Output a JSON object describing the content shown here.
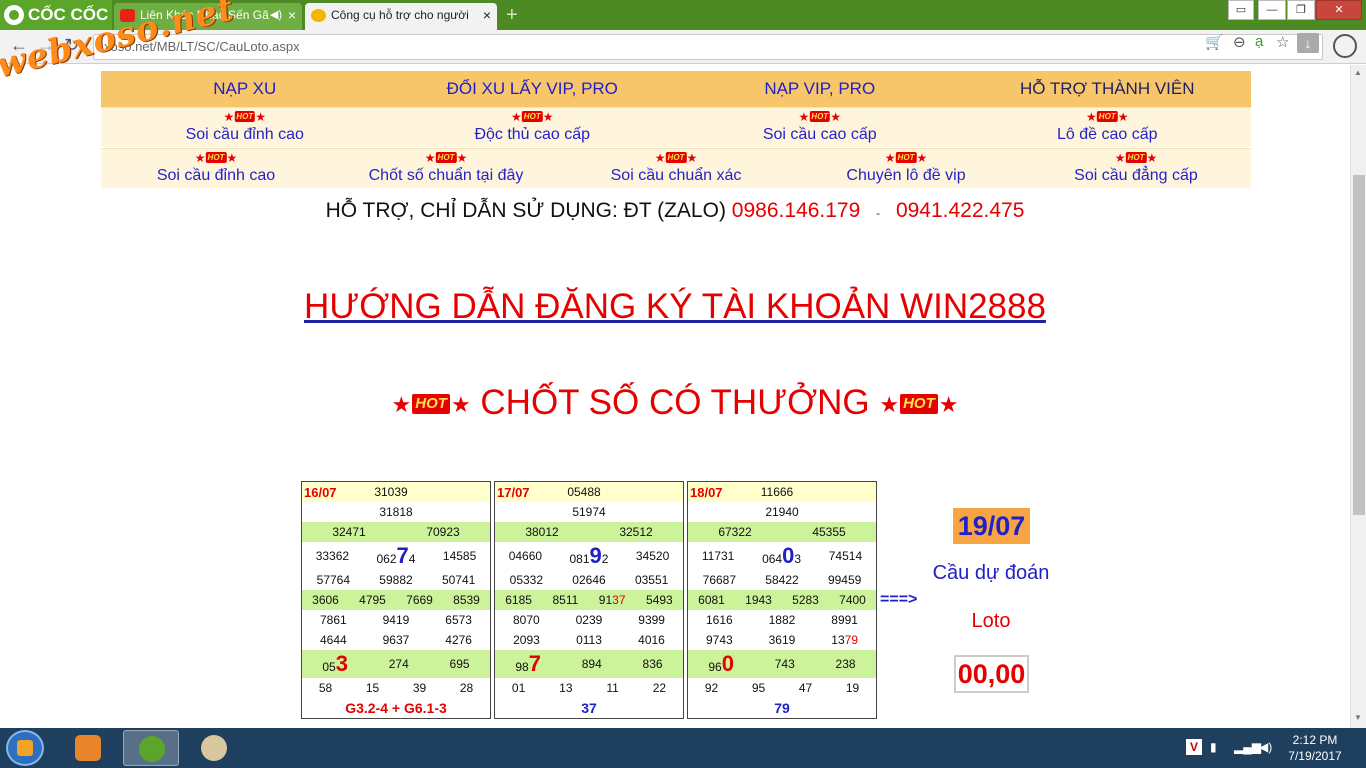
{
  "browser": {
    "brand": "CỐC CỐC",
    "tabs": [
      {
        "title": "Liên Khúc Nhạc Sến Gã",
        "active": false
      },
      {
        "title": "Công cụ hỗ trợ cho người",
        "active": true
      }
    ],
    "url": "xoso.net/MB/LT/SC/CauLoto.aspx",
    "window_buttons": {
      "minimize": "—",
      "restore": "❐",
      "close": "✕"
    }
  },
  "watermark": "webxoso.net",
  "nav": {
    "top_items": [
      "NẠP XU",
      "ĐỔI XU LẤY VIP, PRO",
      "NẠP VIP, PRO",
      "HỖ TRỢ THÀNH VIÊN"
    ],
    "hot_label": "HOT",
    "row1": [
      "Soi cầu đỉnh cao",
      "Độc thủ cao cấp",
      "Soi cầu cao cấp",
      "Lô đề cao cấp"
    ],
    "row2": [
      "Soi cầu đỉnh cao",
      "Chốt số chuẩn tại đây",
      "Soi cầu chuẩn xác",
      "Chuyên lô đề vip",
      "Soi cầu đẳng cấp"
    ]
  },
  "support": {
    "text": "HỖ TRỢ, CHỈ DẪN SỬ DỤNG: ĐT (ZALO)",
    "phone1": "0986.146.179",
    "separator": "-",
    "phone2": "0941.422.475"
  },
  "guide_link": "HƯỚNG DẪN ĐĂNG KÝ TÀI KHOẢN WIN2888",
  "chot_title": "CHỐT SỐ CÓ THƯỞNG",
  "tables": [
    {
      "date": "16/07",
      "special": "31039",
      "g1": "31818",
      "g2": [
        "32471",
        "70923"
      ],
      "g3": [
        "33362",
        "062",
        "7",
        "4",
        "14585",
        "57764",
        "59882",
        "50741"
      ],
      "g4": [
        "3606",
        "4795",
        "7669",
        "8539"
      ],
      "g5": [
        "7861",
        "9419",
        "6573",
        "4644",
        "9637",
        "4276"
      ],
      "g6_pre": "05",
      "g6_big": "3",
      "g6": [
        "274",
        "695"
      ],
      "g7": [
        "58",
        "15",
        "39",
        "28"
      ],
      "footer": "G3.2-4 + G6.1-3"
    },
    {
      "date": "17/07",
      "special": "05488",
      "g1": "51974",
      "g2": [
        "38012",
        "32512"
      ],
      "g3": [
        "04660",
        "081",
        "9",
        "2",
        "34520",
        "05332",
        "02646",
        "03551"
      ],
      "g4": [
        "6185",
        "8511",
        "91",
        "37",
        "5493"
      ],
      "g5": [
        "8070",
        "0239",
        "9399",
        "2093",
        "0113",
        "4016"
      ],
      "g6_pre": "98",
      "g6_big": "7",
      "g6": [
        "894",
        "836"
      ],
      "g7": [
        "01",
        "13",
        "11",
        "22"
      ],
      "footer": "37"
    },
    {
      "date": "18/07",
      "special": "11666",
      "g1": "21940",
      "g2": [
        "67322",
        "45355"
      ],
      "g3": [
        "11731",
        "064",
        "0",
        "3",
        "74514",
        "76687",
        "58422",
        "99459"
      ],
      "g4": [
        "6081",
        "1943",
        "5283",
        "7400"
      ],
      "g5": [
        "1616",
        "1882",
        "8991",
        "9743",
        "3619",
        "13",
        "79"
      ],
      "g6_pre": "96",
      "g6_big": "0",
      "g6": [
        "743",
        "238"
      ],
      "g7": [
        "92",
        "95",
        "47",
        "19"
      ],
      "footer": "79"
    }
  ],
  "prediction": {
    "arrow": "===>",
    "date": "19/07",
    "label": "Cầu dự đoán",
    "type": "Loto",
    "value": "00,00"
  },
  "taskbar": {
    "time": "2:12 PM",
    "date": "7/19/2017"
  }
}
